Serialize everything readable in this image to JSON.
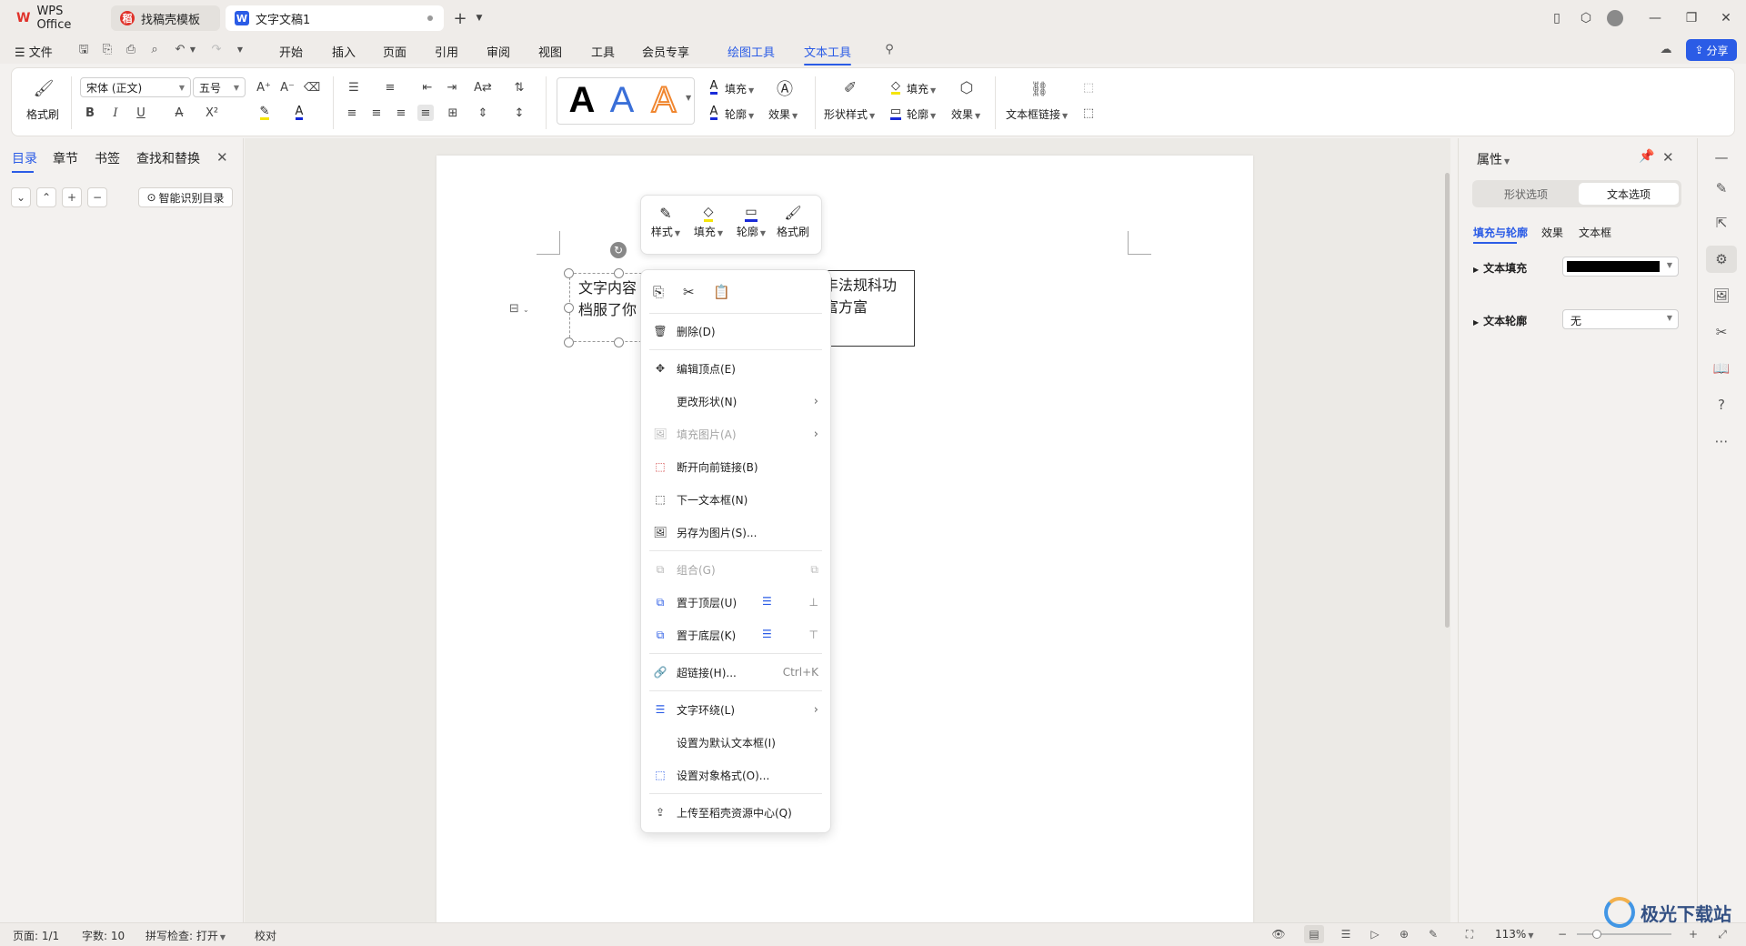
{
  "tabs": [
    {
      "label": "WPS Office",
      "icon": "wps-logo-icon"
    },
    {
      "label": "找稿壳模板",
      "icon": "template-icon"
    },
    {
      "label": "文字文稿1",
      "icon": "writer-doc-icon"
    }
  ],
  "menu": {
    "file": "文件",
    "items": [
      "开始",
      "插入",
      "页面",
      "引用",
      "审阅",
      "视图",
      "工具",
      "会员专享"
    ],
    "context_tabs": [
      "绘图工具",
      "文本工具"
    ],
    "share": "分享"
  },
  "ribbon": {
    "format_painter": "格式刷",
    "font_name": "宋体 (正文)",
    "font_size": "五号",
    "fill": "填充",
    "outline": "轮廓",
    "effect": "效果",
    "shape_style": "形状样式",
    "textbox_link": "文本框链接",
    "text_style_letter": "A"
  },
  "left_panel": {
    "tabs": [
      "目录",
      "章节",
      "书签",
      "查找和替换"
    ],
    "smart_toc": "智能识别目录"
  },
  "document": {
    "textbox1_lines": [
      "文字内容",
      "档服了你"
    ],
    "textbox2_lines": [
      "丰法规科功",
      "富方富"
    ]
  },
  "mini_toolbar": [
    "样式",
    "填充",
    "轮廓",
    "格式刷"
  ],
  "context_menu": [
    {
      "label": "删除(D)",
      "icon": "trash-icon",
      "enabled": true
    },
    {
      "label": "编辑顶点(E)",
      "icon": "edit-points-icon",
      "enabled": true
    },
    {
      "label": "更改形状(N)",
      "icon": "",
      "enabled": true,
      "submenu": true
    },
    {
      "label": "填充图片(A)",
      "icon": "fill-picture-icon",
      "enabled": false,
      "submenu": true
    },
    {
      "label": "断开向前链接(B)",
      "icon": "break-link-icon",
      "enabled": true
    },
    {
      "label": "下一文本框(N)",
      "icon": "next-textbox-icon",
      "enabled": true
    },
    {
      "label": "另存为图片(S)...",
      "icon": "save-image-icon",
      "enabled": true
    },
    {
      "label": "组合(G)",
      "icon": "group-icon",
      "enabled": false
    },
    {
      "label": "置于顶层(U)",
      "icon": "bring-front-icon",
      "enabled": true
    },
    {
      "label": "置于底层(K)",
      "icon": "send-back-icon",
      "enabled": true
    },
    {
      "label": "超链接(H)...",
      "icon": "hyperlink-icon",
      "enabled": true,
      "shortcut": "Ctrl+K"
    },
    {
      "label": "文字环绕(L)",
      "icon": "text-wrap-icon",
      "enabled": true,
      "submenu": true
    },
    {
      "label": "设置为默认文本框(I)",
      "icon": "",
      "enabled": true
    },
    {
      "label": "设置对象格式(O)...",
      "icon": "format-object-icon",
      "enabled": true
    },
    {
      "label": "上传至稻壳资源中心(Q)",
      "icon": "upload-icon",
      "enabled": true
    }
  ],
  "right_panel": {
    "title": "属性",
    "tabs": [
      "形状选项",
      "文本选项"
    ],
    "subtabs": [
      "填充与轮廓",
      "效果",
      "文本框"
    ],
    "text_fill_label": "文本填充",
    "text_fill_color": "#000000",
    "text_outline_label": "文本轮廓",
    "text_outline_value": "无"
  },
  "status": {
    "page": "页面: 1/1",
    "words": "字数: 10",
    "spell": "拼写检查: 打开",
    "proof": "校对",
    "zoom": "113%"
  },
  "watermark": "极光下载站",
  "colors": {
    "accent": "#2b5ce6",
    "wps_red": "#e0322a"
  }
}
